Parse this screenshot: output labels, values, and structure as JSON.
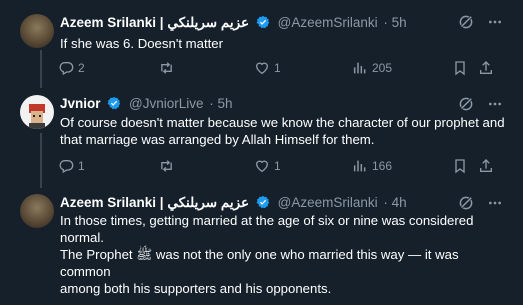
{
  "tweets": [
    {
      "name": "Azeem Srilanki | عزيم سريلنكي",
      "handle": "@AzeemSrilanki",
      "time": "· 5h",
      "lines": [
        "If she was 6. Doesn't matter"
      ],
      "replies": "2",
      "retweets": "",
      "likes": "1",
      "views": "205"
    },
    {
      "name": "Jvnior",
      "handle": "@JvniorLive",
      "time": "· 5h",
      "lines": [
        "Of course doesn't matter because we know the character of our prophet and",
        "that marriage was arranged by Allah Himself for them."
      ],
      "replies": "1",
      "retweets": "",
      "likes": "1",
      "views": "166"
    },
    {
      "name": "Azeem Srilanki | عزيم سريلنكي",
      "handle": "@AzeemSrilanki",
      "time": "· 4h",
      "lines": [
        "In those times, getting married at the age of six or nine was considered",
        "normal.",
        "The Prophet ﷺ was not the only one who married this way — it was common",
        "among both his supporters and his opponents."
      ],
      "replies": "",
      "retweets": "",
      "likes": "",
      "views": ""
    }
  ],
  "colors": {
    "background": "#15202b",
    "text": "#ffffff",
    "muted": "#8b98a5",
    "verified": "#1d9bf0",
    "thread_line": "#38444d"
  },
  "icons": [
    "grok-icon",
    "more-icon",
    "reply-icon",
    "retweet-icon",
    "like-icon",
    "views-icon",
    "bookmark-icon",
    "share-icon"
  ]
}
